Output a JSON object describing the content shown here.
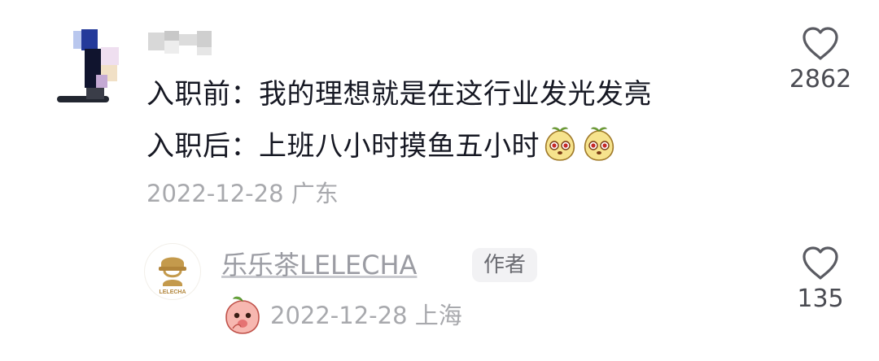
{
  "comment": {
    "line1": "入职前：我的理想就是在这行业发光发亮",
    "line2": "入职后：上班八小时摸鱼五小时",
    "meta": "2022-12-28 广东",
    "like_count": "2862"
  },
  "reply": {
    "username": "乐乐茶LELECHA",
    "author_badge": "作者",
    "meta": "2022-12-28 上海",
    "like_count": "135",
    "avatar_logo_text": "LELECHA"
  },
  "colors": {
    "text_primary": "#161823",
    "text_meta": "#a8a9ad",
    "reply_name": "#9b9ca3",
    "brand_tan": "#c49a4c"
  },
  "icons": [
    "heart-outline-icon",
    "peach-face-emoji"
  ]
}
